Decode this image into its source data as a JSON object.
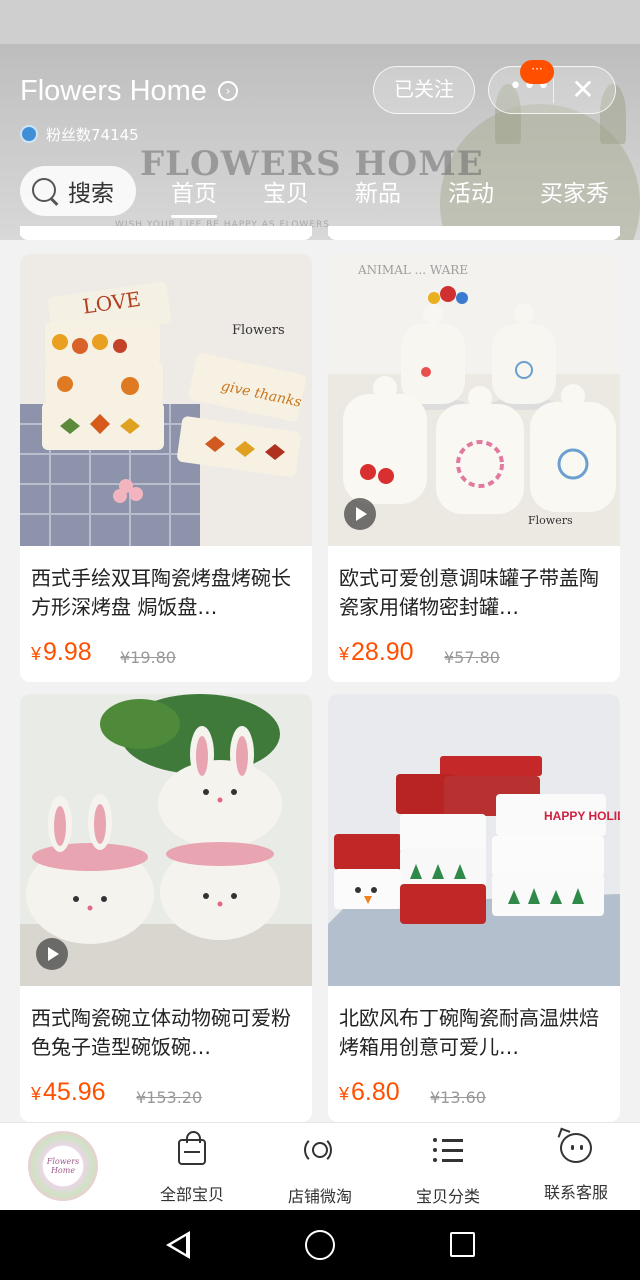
{
  "header": {
    "shop_name": "Flowers Home",
    "fans_text": "粉丝数74145",
    "follow_label": "已关注",
    "more_label": "•••",
    "close_label": "✕",
    "badge_label": "···",
    "background_brand": "FLOWERS HOME",
    "background_tagline": "WISH YOUR LIFE BE HAPPY AS FLOWERS"
  },
  "search": {
    "label": "搜索"
  },
  "tabs": [
    {
      "label": "首页",
      "active": true
    },
    {
      "label": "宝贝",
      "active": false
    },
    {
      "label": "新品",
      "active": false
    },
    {
      "label": "活动",
      "active": false
    },
    {
      "label": "买家秀",
      "active": false
    }
  ],
  "products": [
    {
      "title": "西式手绘双耳陶瓷烤盘烤碗长方形深烤盘 焗饭盘…",
      "currency": "¥",
      "price": "9.98",
      "original_price": "¥19.80",
      "has_video": false,
      "image_caption": "Flowers"
    },
    {
      "title": "欧式可爱创意调味罐子带盖陶瓷家用储物密封罐…",
      "currency": "¥",
      "price": "28.90",
      "original_price": "¥57.80",
      "has_video": true,
      "image_caption": "Flowers"
    },
    {
      "title": "西式陶瓷碗立体动物碗可爱粉色兔子造型碗饭碗…",
      "currency": "¥",
      "price": "45.96",
      "original_price": "¥153.20",
      "has_video": true,
      "image_caption": ""
    },
    {
      "title": "北欧风布丁碗陶瓷耐高温烘焙烤箱用创意可爱儿…",
      "currency": "¥",
      "price": "6.80",
      "original_price": "¥13.60",
      "has_video": false,
      "image_caption": "HAPPY HOLIDAYS"
    }
  ],
  "bottom_bar": {
    "logo_text": "Flowers Home",
    "items": [
      {
        "label": "全部宝贝",
        "icon": "shopping-bag-icon"
      },
      {
        "label": "店铺微淘",
        "icon": "broadcast-icon"
      },
      {
        "label": "宝贝分类",
        "icon": "list-icon"
      },
      {
        "label": "联系客服",
        "icon": "chat-face-icon"
      }
    ]
  },
  "colors": {
    "accent": "#ff5000",
    "price": "#ff5000",
    "nav_bar": "#000000"
  }
}
